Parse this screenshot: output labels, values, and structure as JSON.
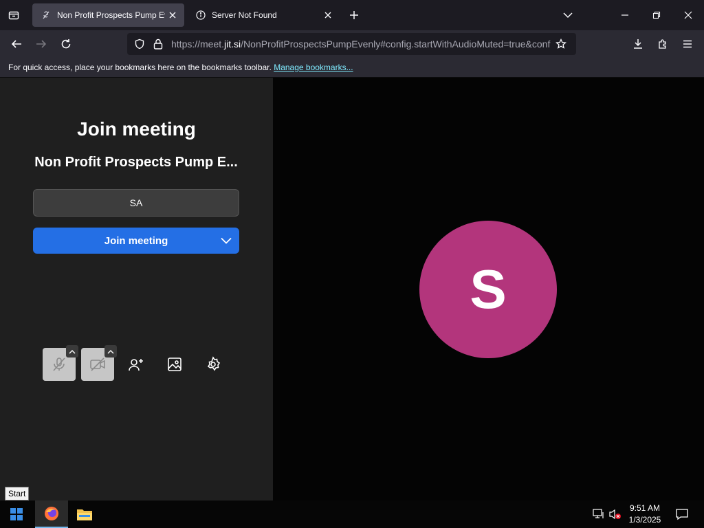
{
  "tabs": [
    {
      "title": "Non Profit Prospects Pump Eve",
      "active": true
    },
    {
      "title": "Server Not Found",
      "active": false
    }
  ],
  "address_bar": {
    "scheme": "https://meet.",
    "host": "jit.si",
    "rest": "/NonProfitProspectsPumpEvenly#config.startWithAudioMuted=true&conf"
  },
  "bookmarks_bar": {
    "message": "For quick access, place your bookmarks here on the bookmarks toolbar.",
    "link": "Manage bookmarks..."
  },
  "prejoin": {
    "heading": "Join meeting",
    "meeting_name": "Non Profit Prospects Pump E...",
    "name_value": "SA",
    "join_button": "Join meeting",
    "avatar_initial": "S",
    "avatar_color": "#b3357c",
    "accent": "#246fe5"
  },
  "taskbar": {
    "start_tooltip": "Start",
    "time": "9:51 AM",
    "date": "1/3/2025"
  }
}
